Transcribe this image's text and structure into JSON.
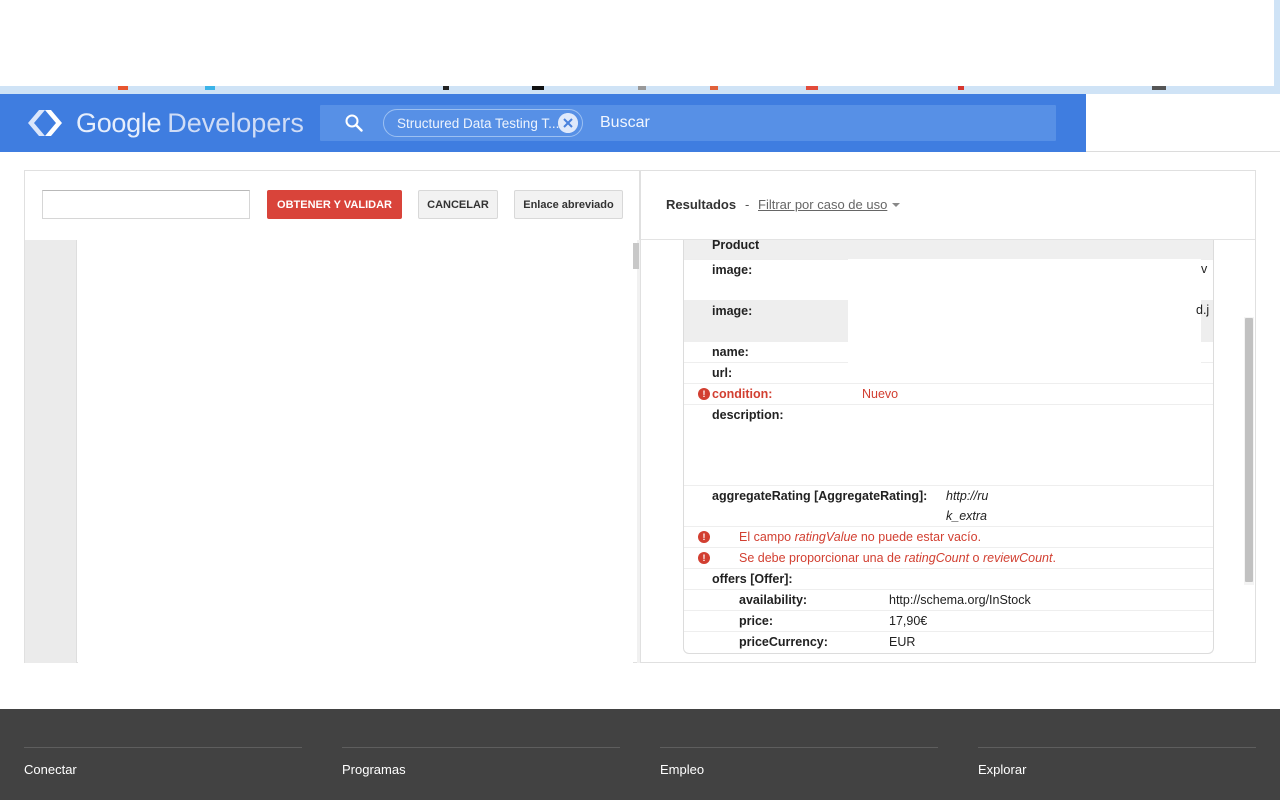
{
  "header": {
    "logo_google": "Google",
    "logo_developers": "Developers",
    "search_chip": "Structured Data Testing T...",
    "search_placeholder": "Buscar"
  },
  "left_panel": {
    "fetch_button": "OBTENER Y VALIDAR",
    "cancel_button": "CANCELAR",
    "short_link_button": "Enlace abreviado"
  },
  "right_panel": {
    "results_title": "Resultados",
    "separator": "-",
    "filter_label": "Filtrar por caso de uso",
    "item_type": "Product",
    "rows": {
      "image1_key": "image:",
      "image1_tail": "v",
      "image2_key": "image:",
      "image2_tail": "d.j",
      "name_key": "name:",
      "url_key": "url:",
      "condition_key": "condition:",
      "condition_value": "Nuevo",
      "description_key": "description:",
      "aggregate_key": "aggregateRating [AggregateRating]:",
      "aggregate_value_line1": "http://ru",
      "aggregate_value_line2": "k_extra",
      "error1_prefix": "El campo",
      "error1_field": "ratingValue",
      "error1_suffix": "no puede estar vacío.",
      "error2_prefix": "Se debe proporcionar una de",
      "error2_field1": "ratingCount",
      "error2_mid": "o",
      "error2_field2": "reviewCount",
      "error2_end": ".",
      "offers_key": "offers [Offer]:",
      "availability_key": "availability:",
      "availability_value": "http://schema.org/InStock",
      "price_key": "price:",
      "price_value": "17,90€",
      "currency_key": "priceCurrency:",
      "currency_value": "EUR"
    }
  },
  "footer": {
    "columns": [
      "Conectar",
      "Programas",
      "Empleo",
      "Explorar"
    ]
  },
  "colors": {
    "header_blue": "#3f7de0",
    "fetch_red": "#d9443a",
    "error_red": "#d23f31",
    "footer_dark": "#424242"
  },
  "icons": [
    "google-developers-logo-icon",
    "search-icon",
    "clear-chip-icon",
    "dropdown-caret-icon",
    "error-icon"
  ]
}
